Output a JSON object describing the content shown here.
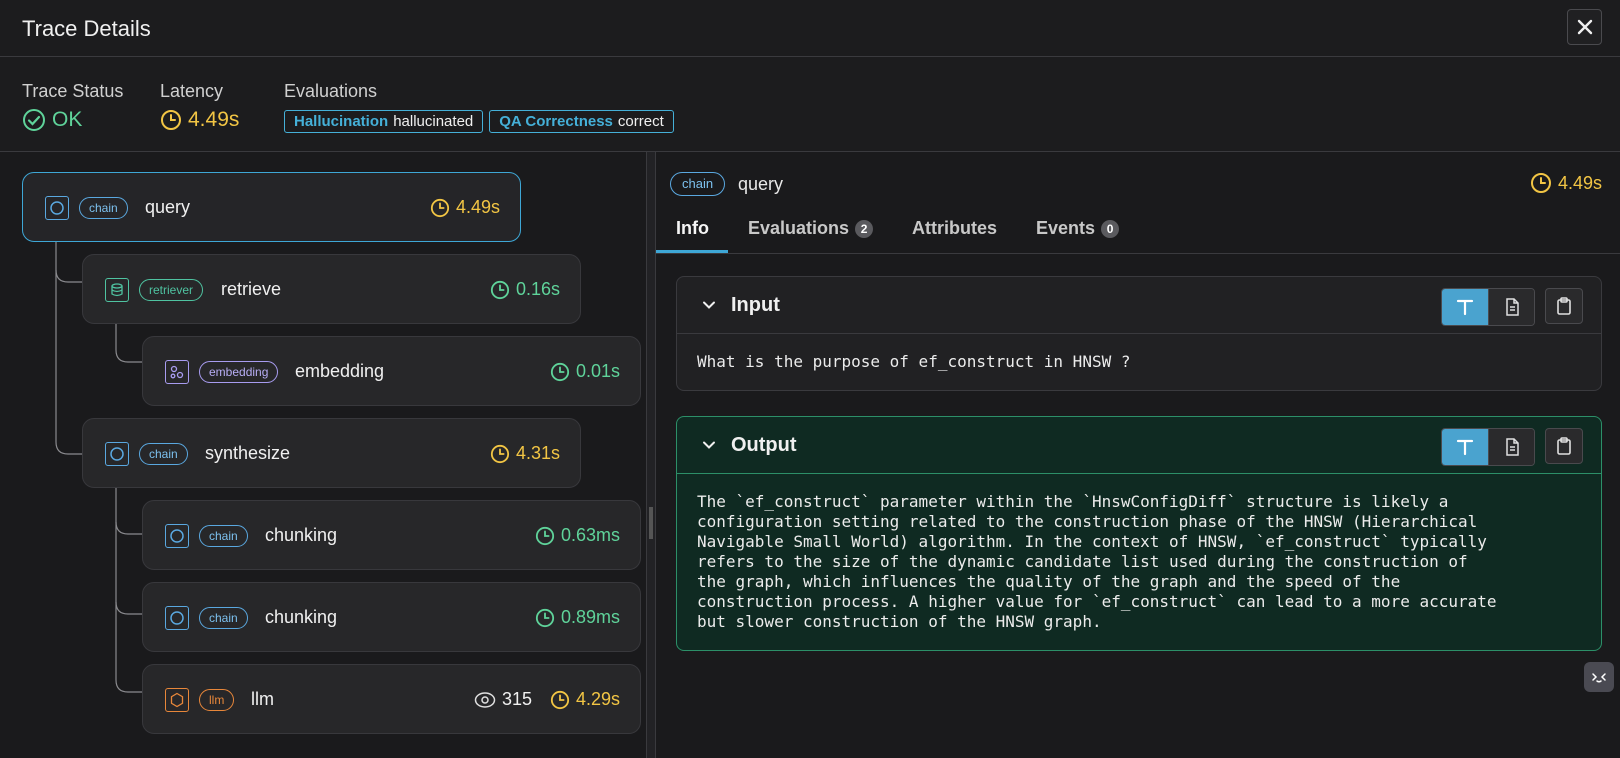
{
  "header": {
    "title": "Trace Details"
  },
  "summary": {
    "status_label": "Trace Status",
    "status_value": "OK",
    "latency_label": "Latency",
    "latency_value": "4.49s",
    "evaluations_label": "Evaluations",
    "evaluations": [
      {
        "name": "Hallucination",
        "value": "hallucinated"
      },
      {
        "name": "QA Correctness",
        "value": "correct"
      }
    ]
  },
  "tree": [
    {
      "kind": "chain",
      "name": "query",
      "latency": "4.49s",
      "latency_color": "#f2c544",
      "icon": "chain-icon",
      "selected": true
    },
    {
      "kind": "retriever",
      "name": "retrieve",
      "latency": "0.16s",
      "latency_color": "#5fd39a",
      "icon": "database-icon"
    },
    {
      "kind": "embedding",
      "name": "embedding",
      "latency": "0.01s",
      "latency_color": "#5fd39a",
      "icon": "embedding-icon"
    },
    {
      "kind": "chain",
      "name": "synthesize",
      "latency": "4.31s",
      "latency_color": "#f2c544",
      "icon": "chain-icon"
    },
    {
      "kind": "chain",
      "name": "chunking",
      "latency": "0.63ms",
      "latency_color": "#5fd39a",
      "icon": "chain-icon"
    },
    {
      "kind": "chain",
      "name": "chunking",
      "latency": "0.89ms",
      "latency_color": "#5fd39a",
      "icon": "chain-icon"
    },
    {
      "kind": "llm",
      "name": "llm",
      "latency": "4.29s",
      "latency_color": "#f2c544",
      "icon": "llm-icon",
      "tokens": "315"
    }
  ],
  "detail": {
    "kind": "chain",
    "name": "query",
    "latency": "4.49s",
    "tabs": [
      {
        "label": "Info"
      },
      {
        "label": "Evaluations",
        "count": "2"
      },
      {
        "label": "Attributes"
      },
      {
        "label": "Events",
        "count": "0"
      }
    ],
    "input": {
      "title": "Input",
      "text": "What is the purpose of ef_construct in HNSW ?"
    },
    "output": {
      "title": "Output",
      "text": "The `ef_construct` parameter within the `HnswConfigDiff` structure is likely a\nconfiguration setting related to the construction phase of the HNSW (Hierarchical\nNavigable Small World) algorithm. In the context of HNSW, `ef_construct` typically\nrefers to the size of the dynamic candidate list used during the construction of\nthe graph, which influences the quality of the graph and the speed of the\nconstruction process. A higher value for `ef_construct` can lead to a more accurate\nbut slower construction of the HNSW graph."
    }
  },
  "colors": {
    "accent": "#3ea7d6",
    "ok": "#5fd39a",
    "warn": "#f2c544",
    "llm": "#e8873a",
    "embedding": "#a89cf0",
    "retriever": "#4fc3a1"
  }
}
